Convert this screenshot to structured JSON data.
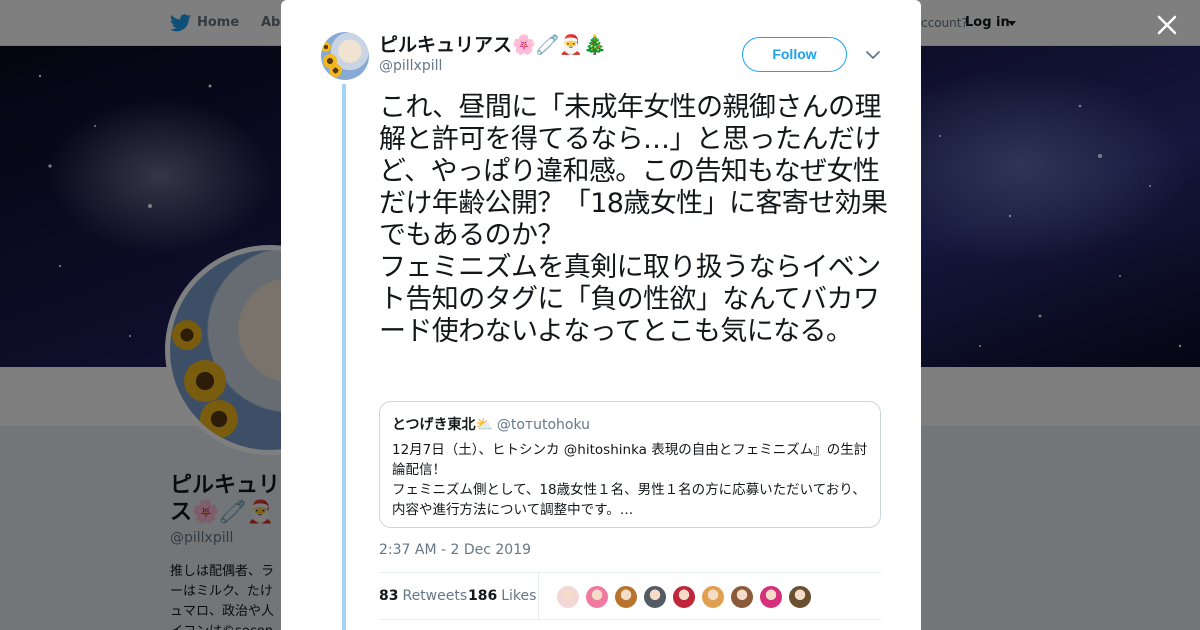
{
  "background_page": {
    "nav": {
      "home_label": "Home",
      "about_label": "Abo",
      "account_text": "ccount?",
      "login_label": "Log in"
    },
    "profile": {
      "name": "ピルキュリ\nス🌸🧷🎅",
      "handle": "@pillxpill",
      "bio": "推しは配偶者、ラ\nーはミルク、たけ\nュマロ、政治や人\nイコンは©secon"
    }
  },
  "tweet": {
    "author_name": "ピルキュリアス🌸🧷🎅🎄",
    "author_handle": "@pillxpill",
    "follow_label": "Follow",
    "text": "これ、昼間に「未成年女性の親御さんの理解と許可を得てるなら…」と思ったんだけど、やっぱり違和感。この告知もなぜ女性だけ年齢公開？「18歳女性」に客寄せ効果でもあるのか？\nフェミニズムを真剣に取り扱うならイベント告知のタグに「負の性欲」なんてバカワード使わないよなってとこも気になる。",
    "quoted": {
      "name": "とつげき東北⛅",
      "handle": "@tотutohoku",
      "body": "12月7日（土）、ヒトシンカ @hitoshinka 表現の自由とフェミニズム』の生討論配信！\nフェミニズム側として、18歳女性１名、男性１名の方に応募いただいており、内容や進行方法について調整中です。…"
    },
    "timestamp": "2:37 AM - 2 Dec 2019",
    "retweets": {
      "count": "83",
      "label": "Retweets"
    },
    "likes": {
      "count": "186",
      "label": "Likes"
    },
    "liker_colors": [
      "#f3d6d6",
      "#f07aa0",
      "#b8742e",
      "#555b66",
      "#c0263a",
      "#e0a050",
      "#8a5a3a",
      "#d6307a",
      "#6b5030"
    ]
  },
  "colors": {
    "accent": "#1da1f2",
    "thread_line": "#a3d4f7",
    "muted": "#657786"
  }
}
